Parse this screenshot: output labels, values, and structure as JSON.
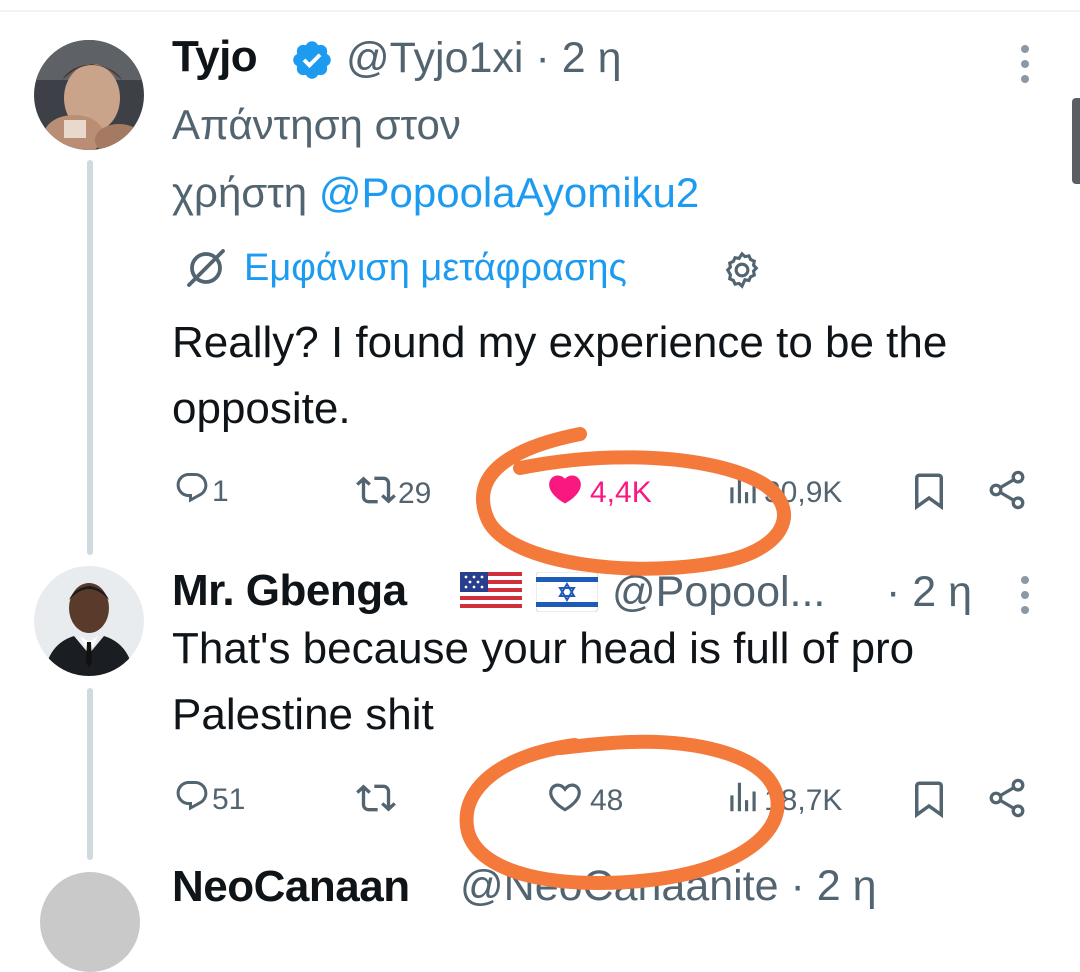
{
  "tweets": [
    {
      "display_name": "Tyjo",
      "verified": true,
      "handle": "@Tyjo1xi",
      "time": "· 2 η",
      "reply_prefix_line1": "Απάντηση στον",
      "reply_prefix_line2": "χρήστη",
      "reply_to_handle": "@PopoolaAyomiku2",
      "translate_label": "Εμφάνιση μετάφρασης",
      "text": "Really? I found my experience to be the opposite.",
      "replies": "1",
      "reposts": "29",
      "likes": "4,4K",
      "liked": true,
      "views": "30,9K"
    },
    {
      "display_name": "Mr. Gbenga",
      "flags": [
        "us-flag",
        "israel-flag"
      ],
      "handle": "@Popool...",
      "time": "· 2 η",
      "text": "That's because your head is full of pro Palestine shit",
      "replies": "51",
      "reposts": "",
      "likes": "48",
      "liked": false,
      "views": "18,7K"
    },
    {
      "display_name": "NeoCanaan",
      "handle": "@NeoCanaanite",
      "time": "· 2 η"
    }
  ],
  "colors": {
    "text": "#0f1419",
    "muted": "#536471",
    "link": "#1d9bf0",
    "like_active": "#f91880",
    "annotation": "#f47a3c"
  }
}
